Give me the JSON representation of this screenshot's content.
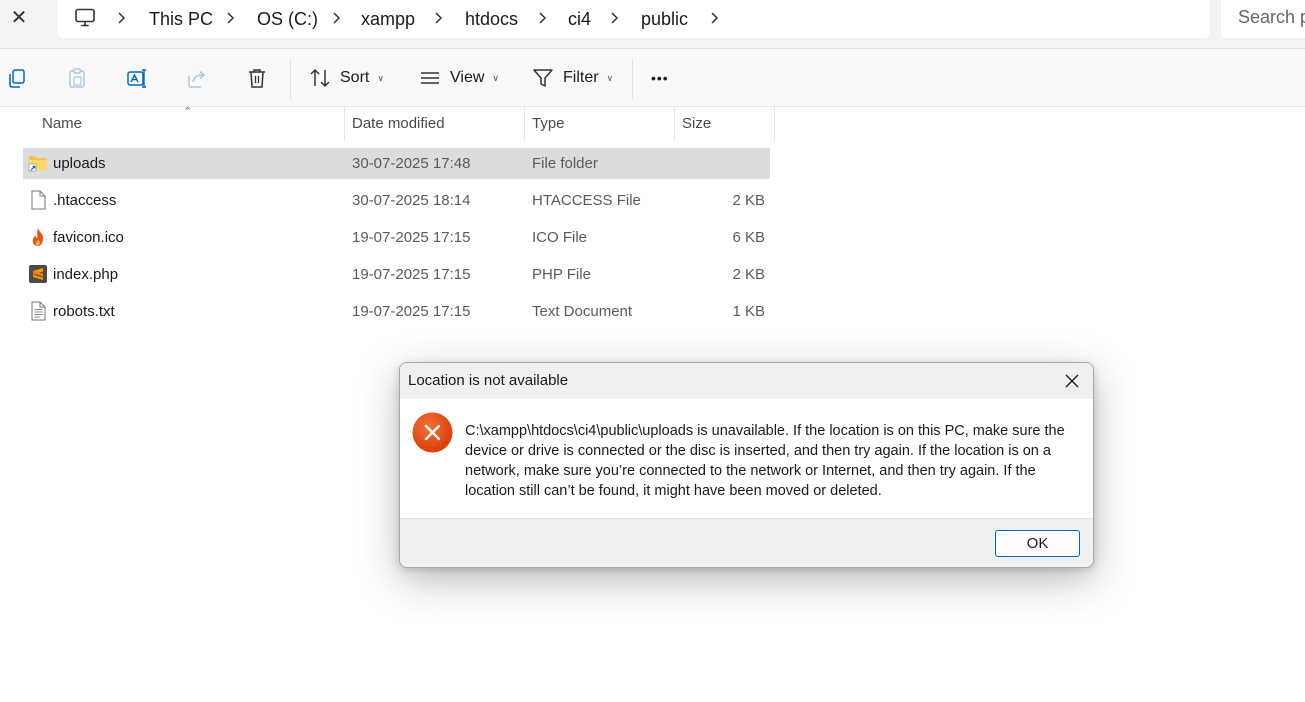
{
  "window": {
    "close_glyph": "✕"
  },
  "breadcrumb": {
    "root_icon": "computer-icon",
    "items": [
      "This PC",
      "OS (C:)",
      "xampp",
      "htdocs",
      "ci4",
      "public"
    ]
  },
  "search": {
    "placeholder": "Search p"
  },
  "toolbar": {
    "icons": [
      "copy-icon",
      "paste-icon",
      "rename-icon",
      "share-icon",
      "delete-icon"
    ],
    "sort_label": "Sort",
    "view_label": "View",
    "filter_label": "Filter",
    "more_glyph": "•••"
  },
  "columns": {
    "name": "Name",
    "date": "Date modified",
    "type": "Type",
    "size": "Size"
  },
  "files": [
    {
      "name": "uploads",
      "date": "30-07-2025 17:48",
      "type": "File folder",
      "size": "",
      "icon": "folder-shortcut-icon",
      "selected": true
    },
    {
      "name": ".htaccess",
      "date": "30-07-2025 18:14",
      "type": "HTACCESS File",
      "size": "2 KB",
      "icon": "blank-file-icon",
      "selected": false
    },
    {
      "name": "favicon.ico",
      "date": "19-07-2025 17:15",
      "type": "ICO File",
      "size": "6 KB",
      "icon": "flame-icon",
      "selected": false
    },
    {
      "name": "index.php",
      "date": "19-07-2025 17:15",
      "type": "PHP File",
      "size": "2 KB",
      "icon": "sublime-file-icon",
      "selected": false
    },
    {
      "name": "robots.txt",
      "date": "19-07-2025 17:15",
      "type": "Text Document",
      "size": "1 KB",
      "icon": "text-file-icon",
      "selected": false
    }
  ],
  "dialog": {
    "title": "Location is not available",
    "message": "C:\\xampp\\htdocs\\ci4\\public\\uploads is unavailable. If the location is on this PC, make sure the device or drive is connected or the disc is inserted, and then try again. If the location is on a network, make sure you’re connected to the network or Internet, and then try again. If the location still can’t be found, it might have been moved or deleted.",
    "ok_label": "OK",
    "error_color": "#d83b01"
  }
}
